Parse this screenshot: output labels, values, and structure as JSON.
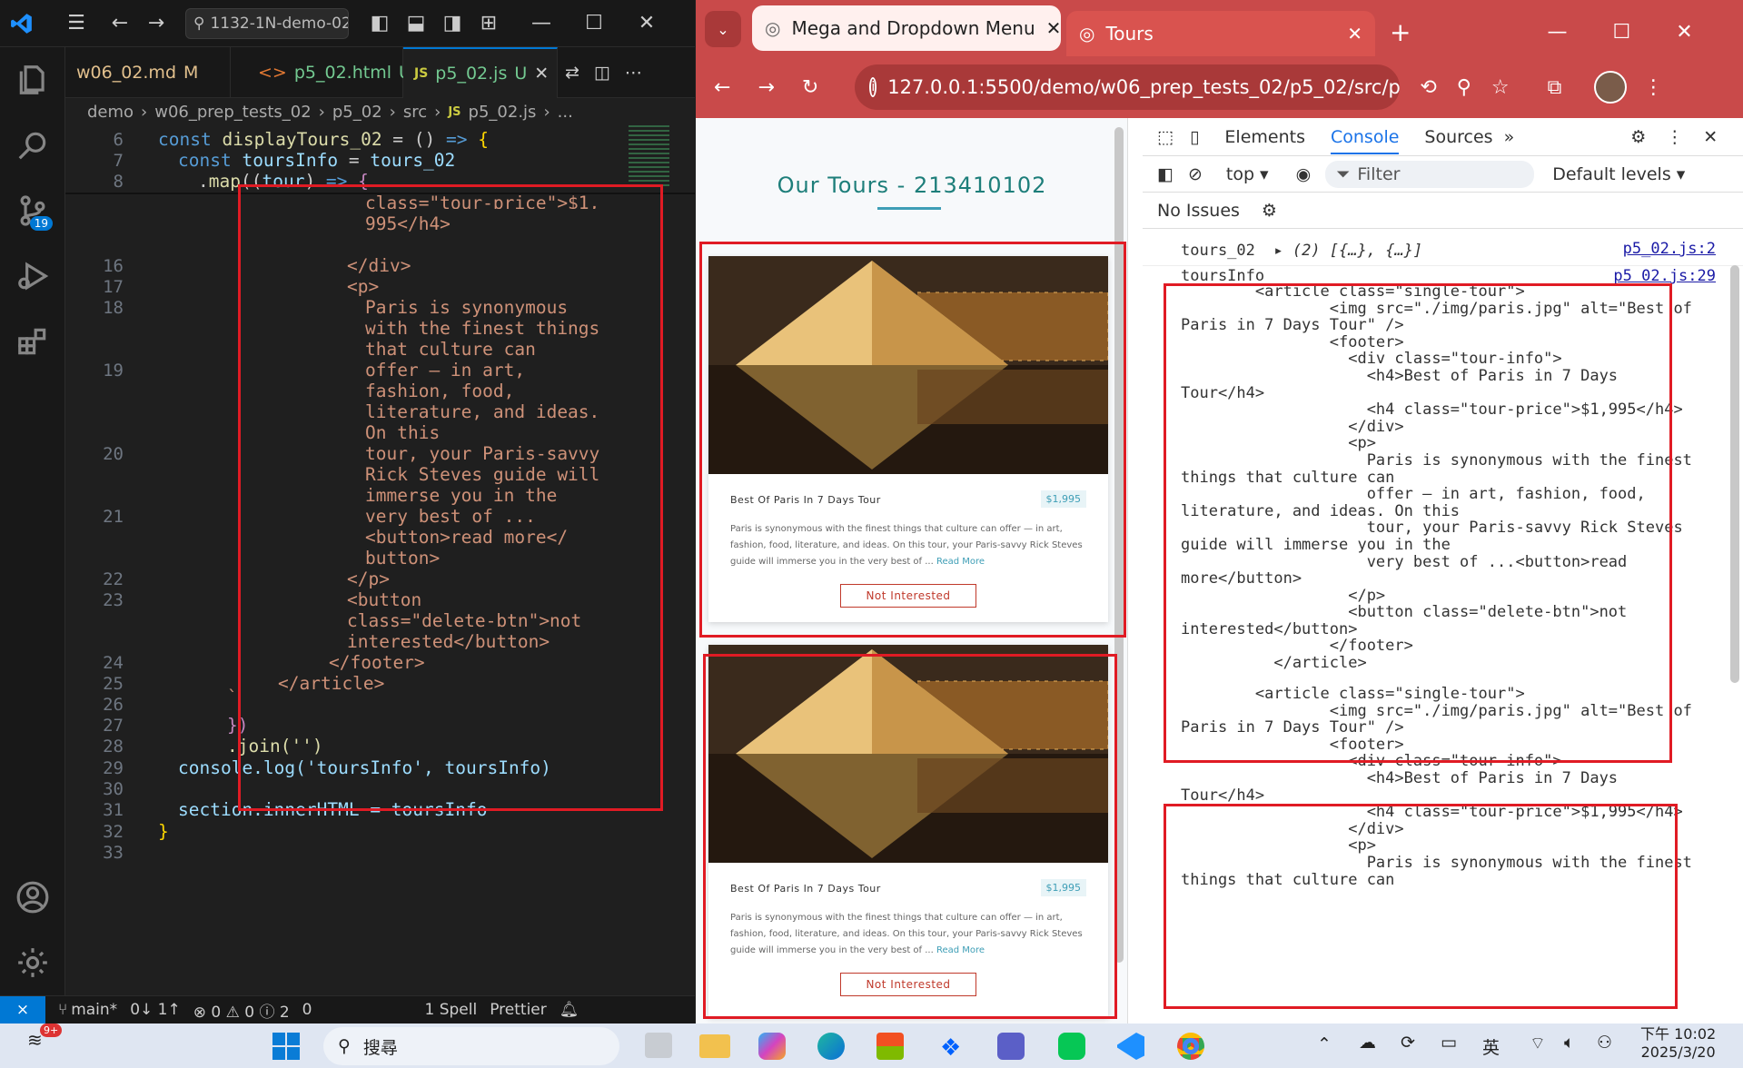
{
  "vscode": {
    "search_text": "1132-1N-demo-02",
    "scm_badge": "19",
    "tabs": [
      {
        "label": "w06_02.md",
        "status": "M"
      },
      {
        "label": "p5_02.html",
        "status": "U"
      },
      {
        "label": "p5_02.js",
        "status": "U"
      }
    ],
    "breadcrumb": [
      "demo",
      "w06_prep_tests_02",
      "p5_02",
      "src",
      "p5_02.js",
      "..."
    ],
    "line_numbers": [
      "6",
      "7",
      "8",
      "16",
      "17",
      "18",
      "19",
      "20",
      "21",
      "22",
      "23",
      "24",
      "25",
      "26",
      "27",
      "28",
      "29",
      "30",
      "31",
      "32",
      "33"
    ],
    "code": {
      "l6": "const displayTours_02 = () => {",
      "l7": "  const toursInfo = tours_02",
      "l8": "    .map((tour) => {",
      "cont1": "class=\"tour-price\">$1,",
      "cont2": "995</h4>",
      "l16": "</div>",
      "l17": "<p>",
      "l18a": "Paris is synonymous",
      "l18b": "with the finest things",
      "l18c": "that culture can",
      "l19a": "offer — in art,",
      "l19b": "fashion, food,",
      "l19c": "literature, and ideas.",
      "l19d": "On this",
      "l20a": "tour, your Paris-savvy",
      "l20b": "Rick Steves guide will",
      "l20c": "immerse you in the",
      "l21a": "very best of ...",
      "l21b": "<button>read more</",
      "l21c": "button>",
      "l22": "</p>",
      "l23a": "<button",
      "l23b": "class=\"delete-btn\">not",
      "l23c": "interested</button>",
      "l24": "</footer>",
      "l25": "</article>",
      "l26": "`",
      "l27": "})",
      "l28": ".join('')",
      "l29": "console.log('toursInfo', toursInfo)",
      "l31": "section.innerHTML = toursInfo",
      "l32": "}"
    },
    "status": {
      "branch": "main*",
      "sync": "0↓ 1↑",
      "problems": "⊗ 0 ⚠ 0 ⓘ 2",
      "ports": "0",
      "spell": "1 Spell",
      "prettier": "Prettier"
    }
  },
  "chrome": {
    "tabs": [
      {
        "label": "Mega and Dropdown Menu"
      },
      {
        "label": "Tours"
      }
    ],
    "url": "127.0.0.1:5500/demo/w06_prep_tests_02/p5_02/src/p...",
    "page": {
      "title": "Our Tours - 213410102",
      "cards": [
        {
          "title": "Best Of Paris In 7 Days Tour",
          "price": "$1,995",
          "desc": "Paris is synonymous with the finest things that culture can offer — in art, fashion, food, literature, and ideas. On this tour, your Paris-savvy Rick Steves guide will immerse you in the very best of ...",
          "read_more": "Read More",
          "button": "Not Interested"
        },
        {
          "title": "Best Of Paris In 7 Days Tour",
          "price": "$1,995",
          "desc": "Paris is synonymous with the finest things that culture can offer — in art, fashion, food, literature, and ideas. On this tour, your Paris-savvy Rick Steves guide will immerse you in the very best of ...",
          "read_more": "Read More",
          "button": "Not Interested"
        }
      ]
    },
    "devtools": {
      "tabs": [
        "Elements",
        "Console",
        "Sources"
      ],
      "context": "top",
      "filter_placeholder": "Filter",
      "levels": "Default levels",
      "issues": "No Issues",
      "log1_label": "tours_02",
      "log1_value": "(2) [{…}, {…}]",
      "log1_src": "p5_02.js:2",
      "log2_label": "toursInfo",
      "log2_src": "p5_02.js:29",
      "block": [
        "        <article class=\"single-tour\">",
        "                <img src=\"./img/paris.jpg\" alt=\"Best of",
        "Paris in 7 Days Tour\" />",
        "                <footer>",
        "                  <div class=\"tour-info\">",
        "                    <h4>Best of Paris in 7 Days",
        "Tour</h4>",
        "                    <h4 class=\"tour-price\">$1,995</h4>",
        "                  </div>",
        "                  <p>",
        "                    Paris is synonymous with the finest",
        "things that culture can",
        "                    offer — in art, fashion, food,",
        "literature, and ideas. On this",
        "                    tour, your Paris-savvy Rick Steves",
        "guide will immerse you in the",
        "                    very best of ...<button>read",
        "more</button>",
        "                  </p>",
        "                  <button class=\"delete-btn\">not",
        "interested</button>",
        "                </footer>",
        "          </article>"
      ],
      "block2": [
        "        <article class=\"single-tour\">",
        "                <img src=\"./img/paris.jpg\" alt=\"Best of",
        "Paris in 7 Days Tour\" />",
        "                <footer>",
        "                  <div class=\"tour-info\">",
        "                    <h4>Best of Paris in 7 Days",
        "Tour</h4>",
        "                    <h4 class=\"tour-price\">$1,995</h4>",
        "                  </div>",
        "                  <p>",
        "                    Paris is synonymous with the finest",
        "things that culture can"
      ]
    }
  },
  "taskbar": {
    "notif_badge": "9+",
    "search_label": "搜尋",
    "ime": "英",
    "time": "下午 10:02",
    "date": "2025/3/20"
  }
}
